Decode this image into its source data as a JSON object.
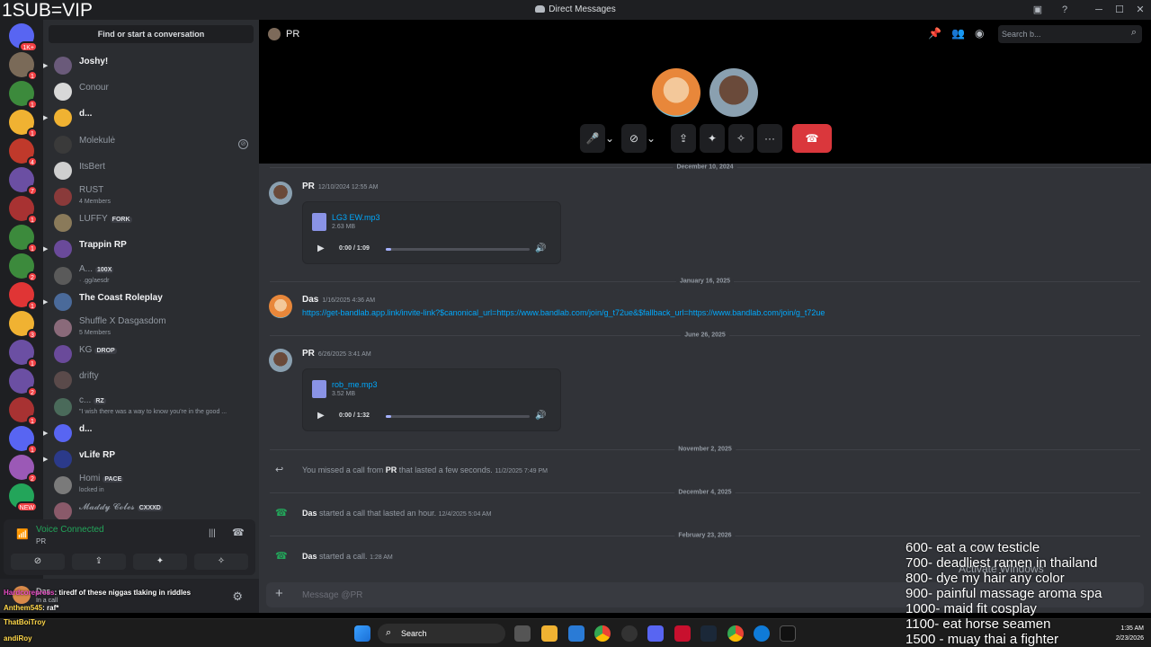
{
  "overlay": {
    "sub_text": "1SUB=VIP",
    "goals": [
      "600- eat a cow testicle",
      "700- deadliest ramen in thailand",
      "800- dye my hair any color",
      "900- painful massage aroma spa",
      "1000- maid fit cosplay",
      "1100- eat horse seamen",
      "1500 - muay thai a fighter"
    ],
    "activate_windows": "Activate Windows",
    "chat": [
      {
        "user": "Hardcorepress",
        "text": ": tiredf of these niggas tlaking in riddles"
      },
      {
        "user": "Anthem545",
        "text": ": raf*"
      },
      {
        "user": "ThatBoiTroy",
        "text": ""
      },
      {
        "user": "andiRoy",
        "text": ""
      }
    ]
  },
  "window": {
    "title": "Direct Messages",
    "minimize": "─",
    "maximize": "☐",
    "close": "✕"
  },
  "rail": {
    "servers": [
      {
        "color": "#5865f2",
        "badge": "1K+"
      },
      {
        "color": "#7a6a58",
        "badge": "1"
      },
      {
        "color": "#3c8a3c",
        "badge": "1"
      },
      {
        "color": "#f0b232",
        "badge": "1"
      },
      {
        "color": "#c0392b",
        "badge": "4"
      },
      {
        "color": "#6b4fa3",
        "badge": "7"
      },
      {
        "color": "#a83232",
        "badge": "1"
      },
      {
        "color": "#3c8a3c",
        "badge": "1"
      },
      {
        "color": "#3c8a3c",
        "badge": "2"
      },
      {
        "color": "#e03535",
        "badge": "1"
      },
      {
        "color": "#f0b232",
        "badge": "3"
      },
      {
        "color": "#6b4fa3",
        "badge": "1"
      },
      {
        "color": "#6b4fa3",
        "badge": "2"
      },
      {
        "color": "#a83232",
        "badge": "1"
      },
      {
        "color": "#5865f2",
        "badge": "1"
      },
      {
        "color": "#9b59b6",
        "badge": "2"
      },
      {
        "color": "#23a55a",
        "badge": "NEW"
      }
    ]
  },
  "dmlist": {
    "find_label": "Find or start a conversation",
    "items": [
      {
        "name": "Joshy!",
        "sub": "",
        "tag": "",
        "strong": true,
        "caret": true,
        "color": "#6a5a7a"
      },
      {
        "name": "Conour",
        "sub": "",
        "tag": "",
        "strong": false,
        "caret": false,
        "color": "#d8d8d8"
      },
      {
        "name": "d...",
        "sub": "",
        "tag": "",
        "strong": true,
        "caret": true,
        "color": "#f0b232"
      },
      {
        "name": "Molekulė",
        "sub": "",
        "tag": "",
        "strong": false,
        "caret": false,
        "color": "#3a3a3a",
        "close": "⊘"
      },
      {
        "name": "ItsBert",
        "sub": "",
        "tag": "",
        "strong": false,
        "caret": false,
        "color": "#cfcfcf"
      },
      {
        "name": "RUST",
        "sub": "4 Members",
        "tag": "",
        "strong": false,
        "caret": false,
        "color": "#8a3a3a"
      },
      {
        "name": "LUFFY",
        "sub": "",
        "tag": "FORK",
        "strong": false,
        "caret": false,
        "color": "#8a7a5a"
      },
      {
        "name": "Trappin RP",
        "sub": "",
        "tag": "",
        "strong": true,
        "caret": true,
        "color": "#6a4a9a"
      },
      {
        "name": "A...",
        "sub": "· .gg/aesdr",
        "tag": "100X",
        "strong": false,
        "caret": false,
        "color": "#5a5a5a"
      },
      {
        "name": "The Coast Roleplay",
        "sub": "",
        "tag": "",
        "strong": true,
        "caret": true,
        "color": "#4a6a9a"
      },
      {
        "name": "Shuffle X Dasgasdom",
        "sub": "5 Members",
        "tag": "",
        "strong": false,
        "caret": false,
        "color": "#8a6a7a"
      },
      {
        "name": "KG",
        "sub": "",
        "tag": "DROP",
        "strong": false,
        "caret": false,
        "color": "#6a4a9a"
      },
      {
        "name": "drifty",
        "sub": "",
        "tag": "",
        "strong": false,
        "caret": false,
        "color": "#5a4a4a"
      },
      {
        "name": "c...",
        "sub": "\"I wish there was a way to know you're in the good ...",
        "tag": "RZ",
        "strong": false,
        "caret": false,
        "color": "#4a6a5a"
      },
      {
        "name": "d...",
        "sub": "",
        "tag": "",
        "strong": true,
        "caret": true,
        "color": "#5865f2"
      },
      {
        "name": "vLife RP",
        "sub": "",
        "tag": "",
        "strong": true,
        "caret": true,
        "color": "#2b3a8a"
      },
      {
        "name": "Homi",
        "sub": "locked in",
        "tag": "PACE",
        "strong": false,
        "caret": false,
        "color": "#7a7a7a"
      },
      {
        "name": "𝓜𝓪𝓭𝓭𝔂 𝓒𝓸𝓵𝓮𝓼",
        "sub": "",
        "tag": "CXXXD",
        "strong": false,
        "caret": false,
        "color": "#8a5a6a"
      }
    ]
  },
  "voice": {
    "status": "Voice Connected",
    "channel": "PR",
    "buttons": [
      "⊘",
      "⇪",
      "✦",
      "✧"
    ]
  },
  "user": {
    "name": "Das",
    "status": "In a call"
  },
  "header": {
    "channel_name": "PR",
    "search_placeholder": "Search b..."
  },
  "call": {
    "controls": [
      "🎤",
      "⌄",
      "⊘",
      "⌄",
      "⇪",
      "✦",
      "✧",
      "···"
    ],
    "end_icon": "☎"
  },
  "messages": {
    "dividers": [
      "December 10, 2024",
      "January 16, 2025",
      "June 26, 2025",
      "November 2, 2025",
      "December 4, 2025",
      "February 23, 2026"
    ],
    "msg1": {
      "author": "PR",
      "ts": "12/10/2024 12:55 AM",
      "file": "LG3 EW.mp3",
      "size": "2.63 MB",
      "time": "0:00 / 1:09"
    },
    "msg2": {
      "author": "Das",
      "ts": "1/16/2025 4:36 AM",
      "link": "https://get-bandlab.app.link/invite-link?$canonical_url=https://www.bandlab.com/join/g_t72ue&$fallback_url=https://www.bandlab.com/join/g_t72ue"
    },
    "msg3": {
      "author": "PR",
      "ts": "6/26/2025 3:41 AM",
      "file": "rob_me.mp3",
      "size": "3.52 MB",
      "time": "0:00 / 1:32"
    },
    "missed": {
      "pre": "You missed a call from ",
      "who": "PR",
      "post": " that lasted a few seconds.",
      "ts": "11/2/2025 7:49 PM"
    },
    "started1": {
      "who": "Das",
      "post": " started a call that lasted an hour.",
      "ts": "12/4/2025 5:04 AM"
    },
    "started2": {
      "who": "Das",
      "post": " started a call.",
      "ts": "1:28 AM"
    }
  },
  "composer": {
    "placeholder": "Message @PR"
  },
  "taskbar": {
    "search_label": "Search",
    "time": "1:35 AM",
    "date": "2/23/2026"
  }
}
